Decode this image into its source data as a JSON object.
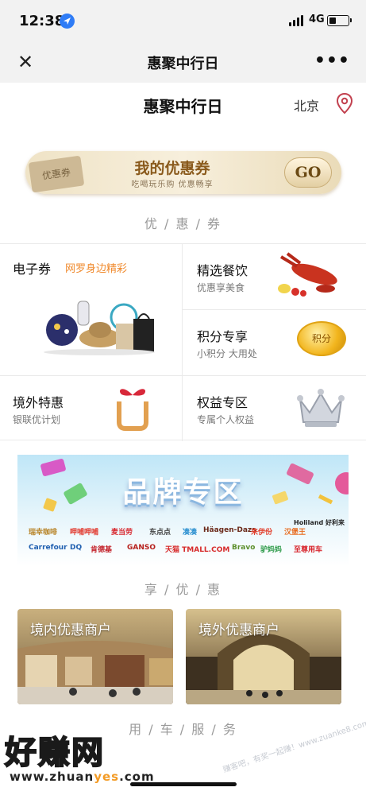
{
  "status_bar": {
    "time": "12:38",
    "network": "4G"
  },
  "nav": {
    "close_glyph": "✕",
    "title": "惠聚中行日",
    "more_glyph": "•••"
  },
  "header": {
    "title": "惠聚中行日",
    "city": "北京"
  },
  "coupon_banner": {
    "tag": "优惠券",
    "title": "我的优惠券",
    "subtitle": "吃喝玩乐购 优惠畅享",
    "go": "GO"
  },
  "sections": {
    "coupons": "优 / 惠 / 券",
    "enjoy": "享 / 优 / 惠",
    "car": "用 / 车 / 服 / 务"
  },
  "grid": {
    "ecoupon": {
      "title": "电子券",
      "tag": "网罗身边精彩"
    },
    "dining": {
      "title": "精选餐饮",
      "sub": "优惠享美食"
    },
    "points": {
      "title": "积分专享",
      "sub": "小积分 大用处",
      "coin_label": "积分"
    },
    "overseas": {
      "title": "境外特惠",
      "sub": "银联优计划"
    },
    "rights": {
      "title": "权益专区",
      "sub": "专属个人权益"
    }
  },
  "brand": {
    "title": "品牌专区",
    "logos": [
      "瑞幸咖啡",
      "呷哺呷哺",
      "麦当劳",
      "东点点",
      "凑凑",
      "Häagen-Dazs",
      "来伊份",
      "汉堡王",
      "Holiland 好利来",
      "Carrefour",
      "DQ",
      "肯德基",
      "GANSO",
      "天猫 TMALL.COM",
      "Bravo",
      "驴妈妈",
      "至尊用车"
    ]
  },
  "merchants": {
    "domestic": "境内优惠商户",
    "overseas": "境外优惠商户"
  },
  "watermark": {
    "text": "好赚网",
    "url_prefix": "www.zhuan",
    "url_highlight": "yes",
    "url_suffix": ".com",
    "side": "赚客吧，有奖一起赚！www.zuanke8.com"
  },
  "colors": {
    "accent": "#f08a2d",
    "gold": "#8a5a1c",
    "pin": "#c2414f",
    "location_blue": "#2f7cf6"
  },
  "icons": [
    "location-arrow-icon",
    "signal-icon",
    "battery-icon",
    "close-icon",
    "more-icon",
    "location-pin-icon",
    "gift-icon",
    "crown-icon",
    "coin-icon"
  ]
}
